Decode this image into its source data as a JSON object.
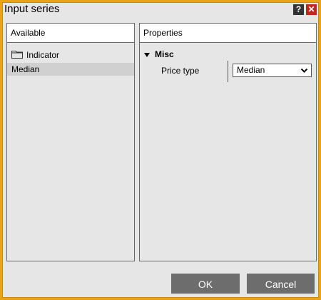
{
  "window": {
    "title": "Input series",
    "help_glyph": "?",
    "close_glyph": "✕"
  },
  "available": {
    "header": "Available",
    "items": [
      {
        "label": "Indicator",
        "icon": "folder-icon"
      },
      {
        "label": "Median",
        "selected": true
      }
    ]
  },
  "properties": {
    "header": "Properties",
    "section": "Misc",
    "rows": [
      {
        "label": "Price type",
        "value": "Median"
      }
    ]
  },
  "buttons": {
    "ok": "OK",
    "cancel": "Cancel"
  },
  "colors": {
    "frame": "#eaa318",
    "close": "#c0271f",
    "button": "#6d6d6d"
  }
}
